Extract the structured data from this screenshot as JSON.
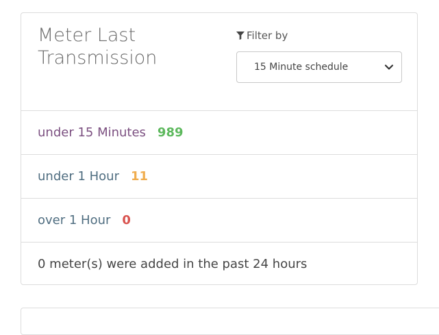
{
  "card": {
    "title": "Meter Last Transmission",
    "filter": {
      "label": "Filter by",
      "icon": "filter-icon",
      "selected": "15 Minute schedule"
    },
    "rows": [
      {
        "label": "under 15 Minutes",
        "value": "989",
        "label_color": "#7b4f80",
        "value_color": "#5cb85c"
      },
      {
        "label": "under 1 Hour",
        "value": "11",
        "label_color": "#4f6d80",
        "value_color": "#f0ad4e"
      },
      {
        "label": "over 1 Hour",
        "value": "0",
        "label_color": "#4f6d80",
        "value_color": "#d9534f"
      }
    ],
    "footer_text": "0 meter(s) were added in the past 24 hours"
  }
}
